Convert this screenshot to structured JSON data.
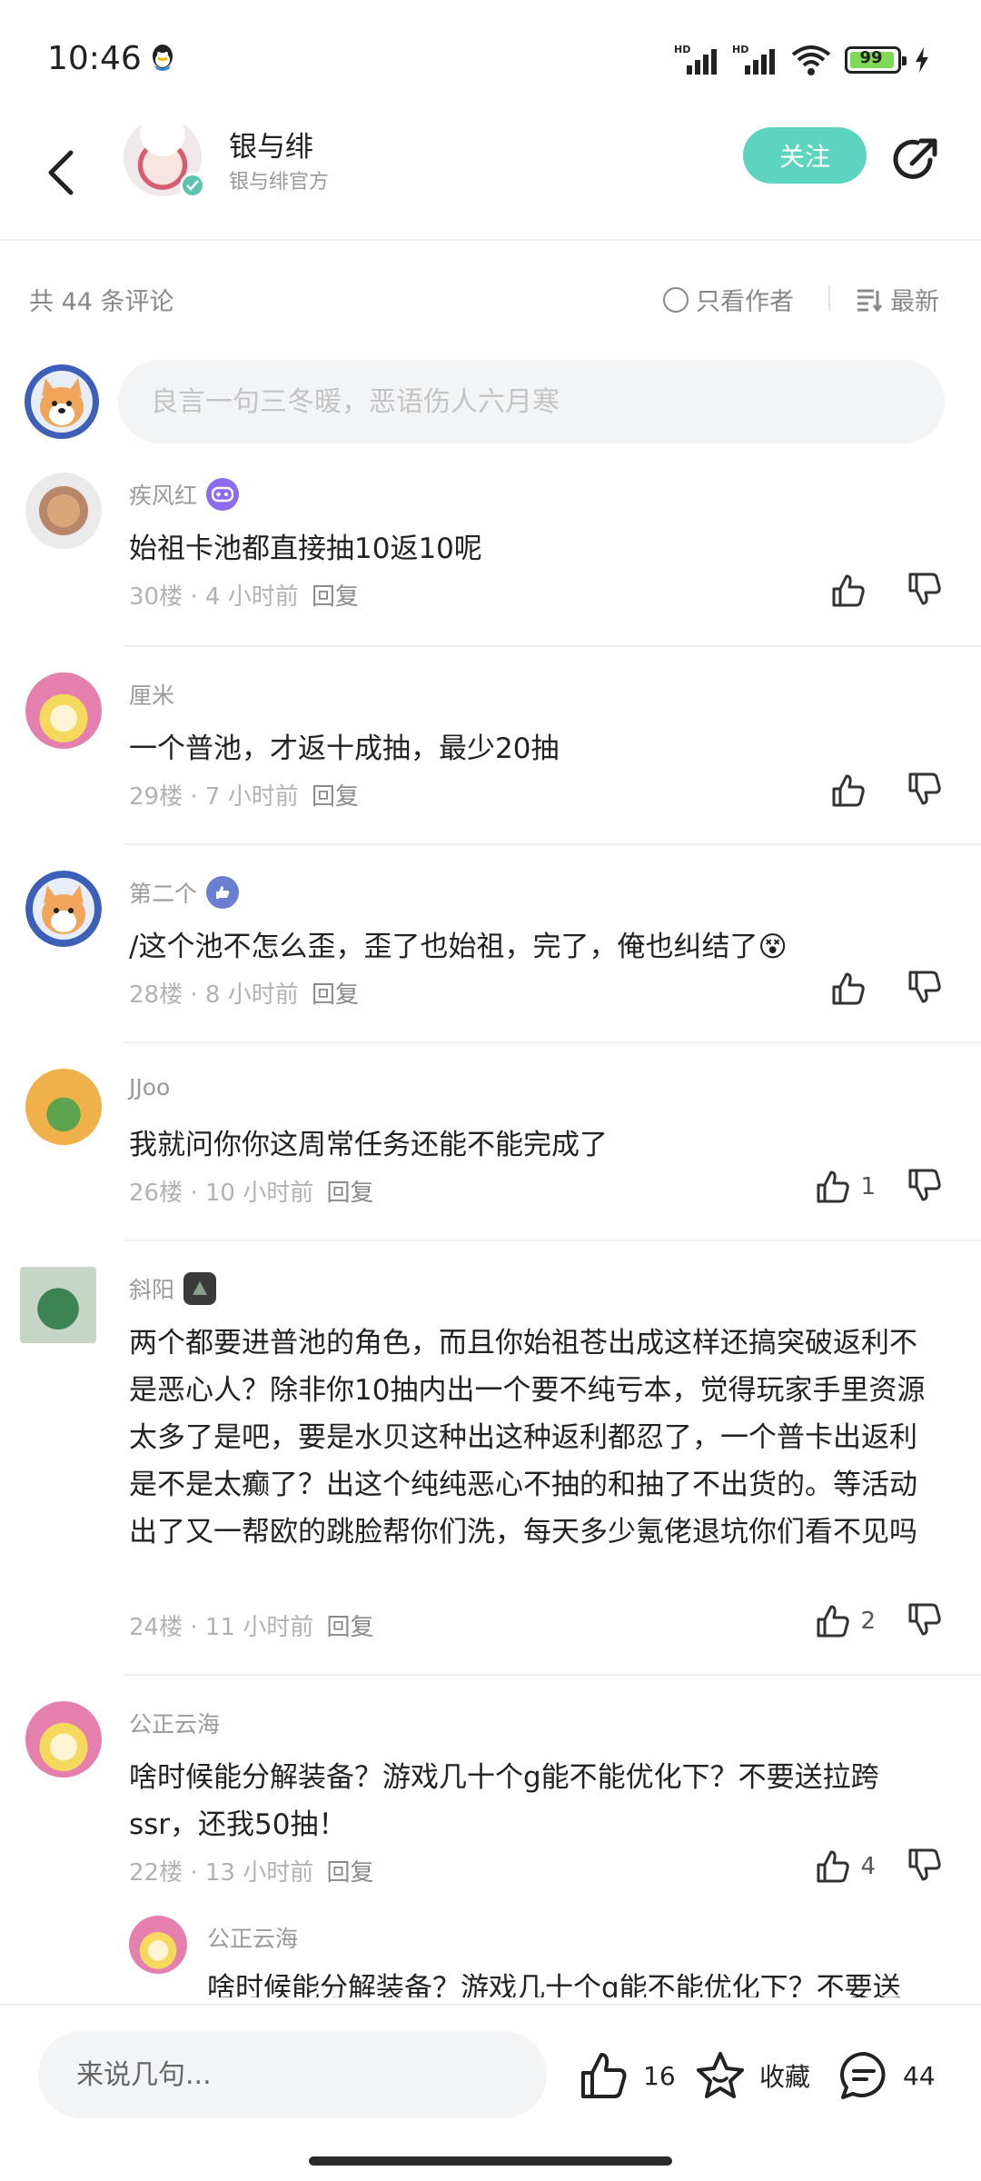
{
  "status_bar": {
    "time": "10:46",
    "battery": "99",
    "signal_label": "HD"
  },
  "header": {
    "name": "银与绯",
    "subtitle": "银与绯官方",
    "follow_label": "关注"
  },
  "filter": {
    "count_text": "共 44 条评论",
    "author_only": "只看作者",
    "sort_label": "最新"
  },
  "composer": {
    "placeholder": "良言一句三冬暖，恶语伤人六月寒"
  },
  "comments": [
    {
      "name": "疾风红",
      "text": "始祖卡池都直接抽10返10呢",
      "floor": "30楼",
      "time": "4 小时前",
      "reply": "回复",
      "likes": ""
    },
    {
      "name": "厘米",
      "text": "一个普池，才返十成抽，最少20抽",
      "floor": "29楼",
      "time": "7 小时前",
      "reply": "回复",
      "likes": ""
    },
    {
      "name": "第二个",
      "text": "/这个池不怎么歪，歪了也始祖，完了，俺也纠结了",
      "emoji": "😵",
      "floor": "28楼",
      "time": "8 小时前",
      "reply": "回复",
      "likes": ""
    },
    {
      "name": "JJoo",
      "text": "我就问你你这周常任务还能不能完成了",
      "floor": "26楼",
      "time": "10 小时前",
      "reply": "回复",
      "likes": "1"
    },
    {
      "name": "斜阳",
      "text": "两个都要进普池的角色，而且你始祖苍出成这样还搞突破返利不是恶心人？除非你10抽内出一个要不纯亏本，觉得玩家手里资源太多了是吧，要是水贝这种出这种返利都忍了，一个普卡出返利是不是太癫了？出这个纯纯恶心不抽的和抽了不出货的。等活动出了又一帮欧的跳脸帮你们洗，每天多少氪佬退坑你们看不见吗",
      "floor": "24楼",
      "time": "11 小时前",
      "reply": "回复",
      "likes": "2"
    },
    {
      "name": "公正云海",
      "text": "啥时候能分解装备？游戏几十个g能不能优化下？不要送拉跨ssr，还我50抽！",
      "floor": "22楼",
      "time": "13 小时前",
      "reply": "回复",
      "likes": "4"
    }
  ],
  "sub_comment": {
    "name": "公正云海",
    "text": "啥时候能分解装备？游戏几十个g能不能优化下？不要送"
  },
  "bottom_bar": {
    "input_placeholder": "来说几句...",
    "like_count": "16",
    "collect_label": "收藏",
    "comment_count": "44"
  },
  "colors": {
    "accent": "#5dd4bf",
    "muted": "#9a9a9a",
    "text": "#222222"
  }
}
